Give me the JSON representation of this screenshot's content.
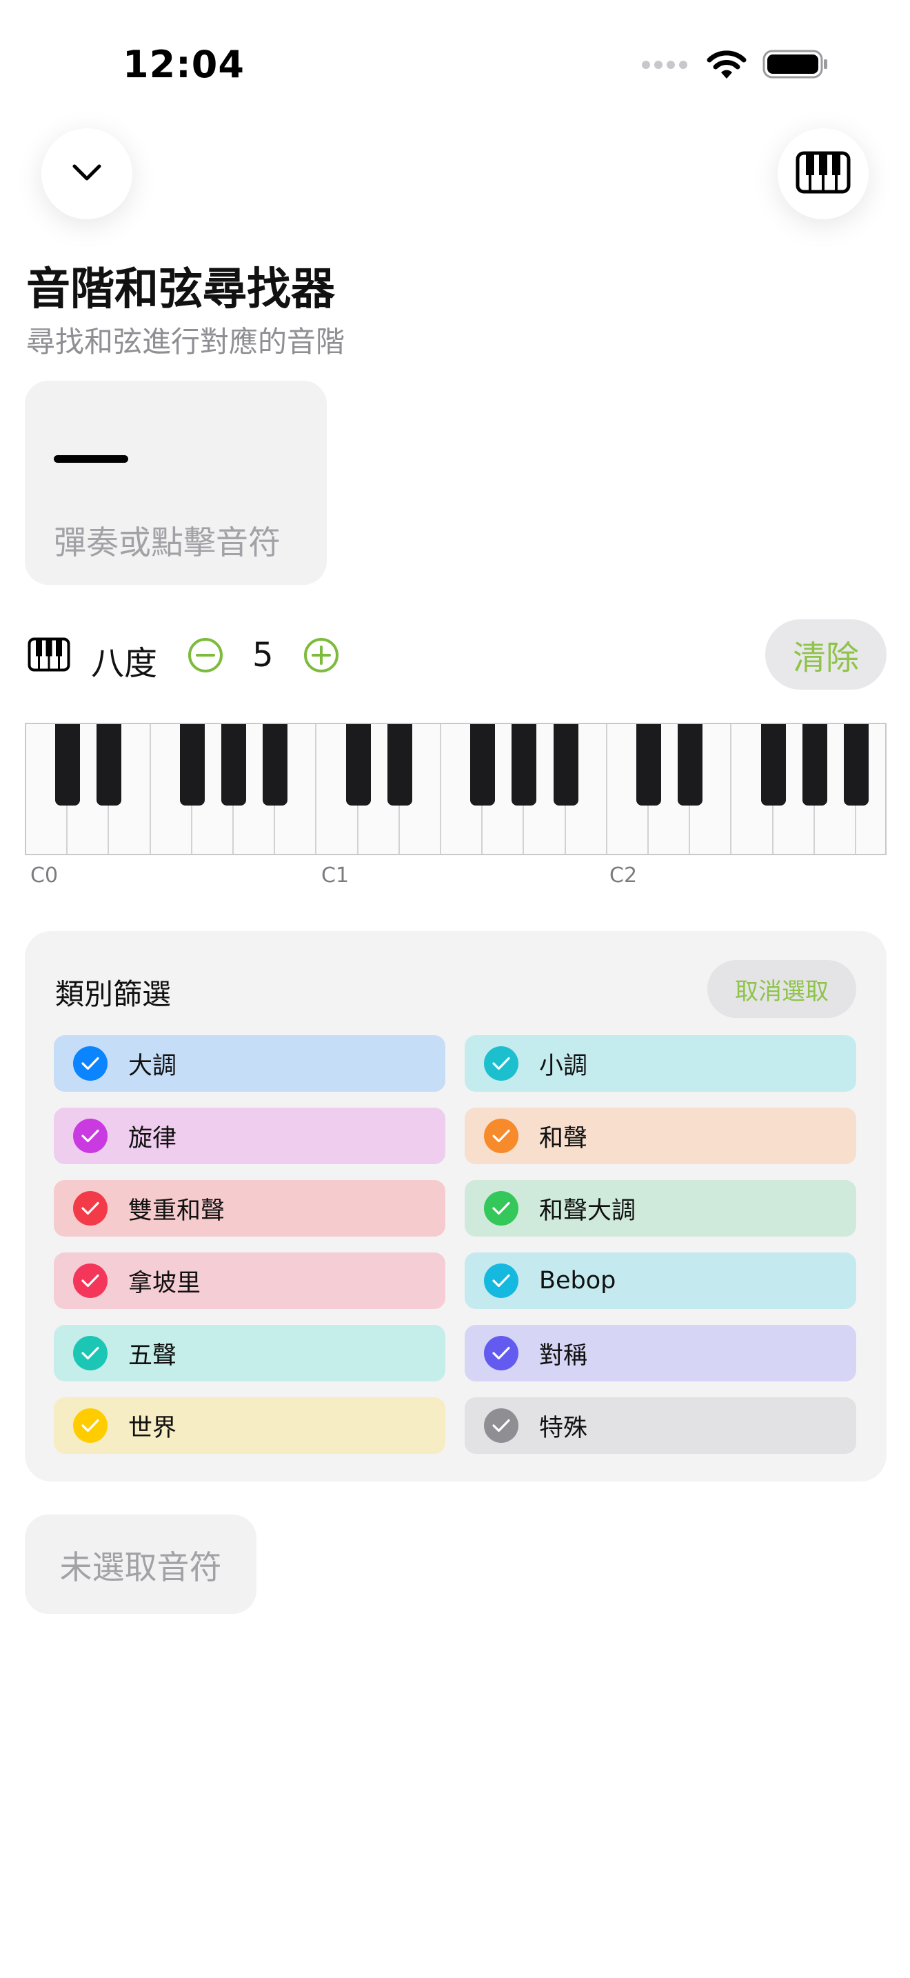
{
  "status_bar": {
    "time": "12:04"
  },
  "header": {
    "collapse_icon": "chevron-down-icon",
    "piano_icon": "piano-icon",
    "title": "音階和弦尋找器",
    "subtitle": "尋找和弦進行對應的音階"
  },
  "note_input": {
    "hint": "彈奏或點擊音符"
  },
  "octave": {
    "label": "八度",
    "value": "5",
    "clear_label": "清除"
  },
  "keyboard": {
    "octave_labels": [
      "C0",
      "C1",
      "C2"
    ]
  },
  "filter": {
    "title": "類別篩選",
    "deselect_label": "取消選取",
    "categories": [
      {
        "label": "大調",
        "checked": true,
        "color": "#0a84ff",
        "bg": "#c5ddf6"
      },
      {
        "label": "小調",
        "checked": true,
        "color": "#1cbfce",
        "bg": "#c4ebee"
      },
      {
        "label": "旋律",
        "checked": true,
        "color": "#c93ae0",
        "bg": "#efcdee"
      },
      {
        "label": "和聲",
        "checked": true,
        "color": "#f78a2a",
        "bg": "#f7decd"
      },
      {
        "label": "雙重和聲",
        "checked": true,
        "color": "#f23a48",
        "bg": "#f6cbcd"
      },
      {
        "label": "和聲大調",
        "checked": true,
        "color": "#34c759",
        "bg": "#cfeada"
      },
      {
        "label": "拿坡里",
        "checked": true,
        "color": "#f3365a",
        "bg": "#f5cdd5"
      },
      {
        "label": "Bebop",
        "checked": true,
        "color": "#15b8de",
        "bg": "#c4eaf0"
      },
      {
        "label": "五聲",
        "checked": true,
        "color": "#1cc6b4",
        "bg": "#c5eeea"
      },
      {
        "label": "對稱",
        "checked": true,
        "color": "#635bf0",
        "bg": "#d6d5f5"
      },
      {
        "label": "世界",
        "checked": true,
        "color": "#ffcc00",
        "bg": "#f6edc4"
      },
      {
        "label": "特殊",
        "checked": true,
        "color": "#8e8e93",
        "bg": "#e2e2e4"
      }
    ]
  },
  "result": {
    "empty_label": "未選取音符"
  }
}
